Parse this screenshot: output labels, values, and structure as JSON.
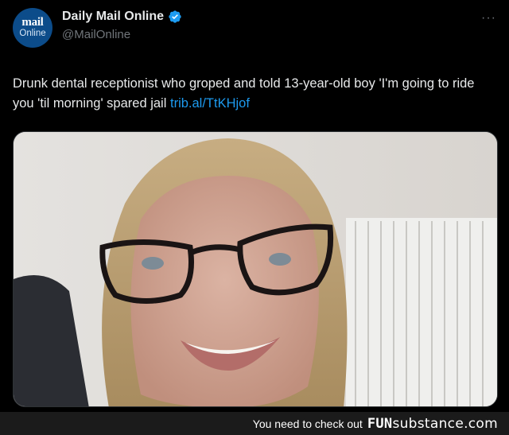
{
  "account": {
    "avatar_line1": "mail",
    "avatar_line2": "Online",
    "display_name": "Daily Mail Online",
    "handle": "@MailOnline"
  },
  "tweet": {
    "text": "Drunk dental receptionist who groped and told 13-year-old boy 'I'm going to ride you 'til morning' spared jail",
    "link": "trib.al/TtKHjof"
  },
  "menu": {
    "more_label": "···"
  },
  "footer": {
    "prompt": "You need to check out",
    "brand_bold": "FUN",
    "brand_rest": "substance.com"
  },
  "colors": {
    "background": "#000000",
    "link": "#1d9bf0",
    "verified": "#1d9bf0",
    "secondary_text": "#71767b",
    "avatar_bg": "#0c4c8a"
  },
  "icons": {
    "verified": "verified-badge-icon",
    "more": "more-options-icon"
  }
}
